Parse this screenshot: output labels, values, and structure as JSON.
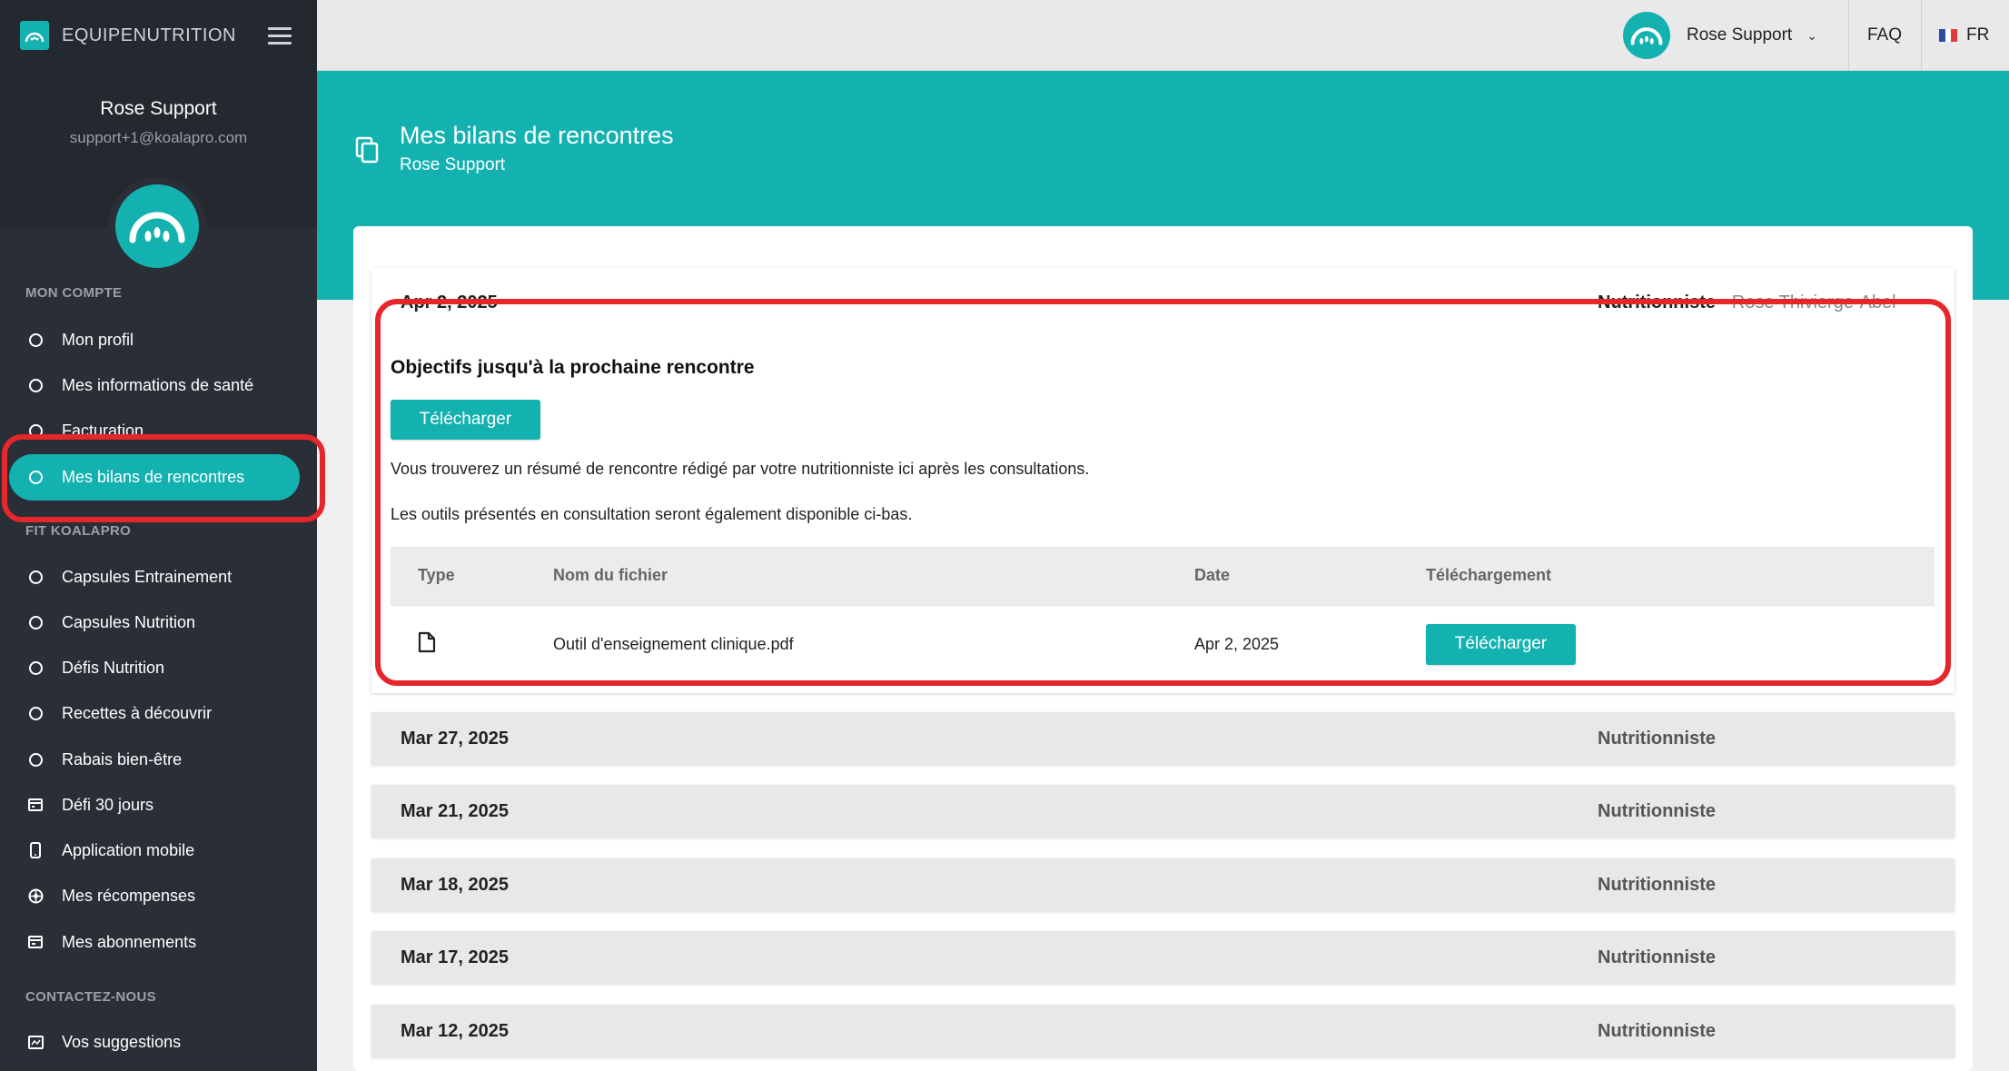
{
  "brand": {
    "name": "EQUIPENUTRITION"
  },
  "user": {
    "name": "Rose Support",
    "email": "support+1@koalapro.com"
  },
  "sidebar": {
    "sections": [
      {
        "label": "MON COMPTE"
      },
      {
        "label": "FIT KOALAPRO"
      },
      {
        "label": "CONTACTEZ-NOUS"
      }
    ],
    "items": [
      {
        "label": "Mon profil",
        "icon": "circle-icon"
      },
      {
        "label": "Mes informations de santé",
        "icon": "circle-icon"
      },
      {
        "label": "Facturation",
        "icon": "circle-icon"
      },
      {
        "label": "Mes bilans de rencontres",
        "icon": "circle-icon",
        "active": true
      },
      {
        "label": "Capsules Entrainement",
        "icon": "circle-icon"
      },
      {
        "label": "Capsules Nutrition",
        "icon": "circle-icon"
      },
      {
        "label": "Défis Nutrition",
        "icon": "circle-icon"
      },
      {
        "label": "Recettes à découvrir",
        "icon": "circle-icon"
      },
      {
        "label": "Rabais bien-être",
        "icon": "circle-icon"
      },
      {
        "label": "Défi 30 jours",
        "icon": "calendar-icon"
      },
      {
        "label": "Application mobile",
        "icon": "mobile-icon"
      },
      {
        "label": "Mes récompenses",
        "icon": "award-icon"
      },
      {
        "label": "Mes abonnements",
        "icon": "card-icon"
      },
      {
        "label": "Vos suggestions",
        "icon": "feedback-icon"
      }
    ]
  },
  "topbar": {
    "user_name": "Rose Support",
    "faq": "FAQ",
    "lang": "FR"
  },
  "header": {
    "title": "Mes bilans de rencontres",
    "subtitle": "Rose Support"
  },
  "open_entry": {
    "date": "Apr 2, 2025",
    "role": "Nutritionniste",
    "practitioner": "Rose Thivierge-Abel",
    "objectives_title": "Objectifs jusqu'à la prochaine rencontre",
    "download_label": "Télécharger",
    "text1": "Vous trouverez un résumé de rencontre rédigé par votre nutritionniste ici après les consultations.",
    "text2": "Les outils présentés en consultation seront également disponible ci-bas.",
    "table": {
      "headers": [
        "Type",
        "Nom du fichier",
        "Date",
        "Téléchargement"
      ],
      "rows": [
        {
          "type_icon": "file-icon",
          "filename": "Outil d'enseignement clinique.pdf",
          "date": "Apr 2, 2025",
          "action": "Télécharger"
        }
      ]
    }
  },
  "entries": [
    {
      "date": "Mar 27, 2025",
      "role": "Nutritionniste"
    },
    {
      "date": "Mar 21, 2025",
      "role": "Nutritionniste"
    },
    {
      "date": "Mar 18, 2025",
      "role": "Nutritionniste"
    },
    {
      "date": "Mar 17, 2025",
      "role": "Nutritionniste"
    },
    {
      "date": "Mar 12, 2025",
      "role": "Nutritionniste"
    }
  ],
  "colors": {
    "accent": "#13b2b1",
    "sidebar": "#2a2e36",
    "highlight": "#e5262b"
  }
}
